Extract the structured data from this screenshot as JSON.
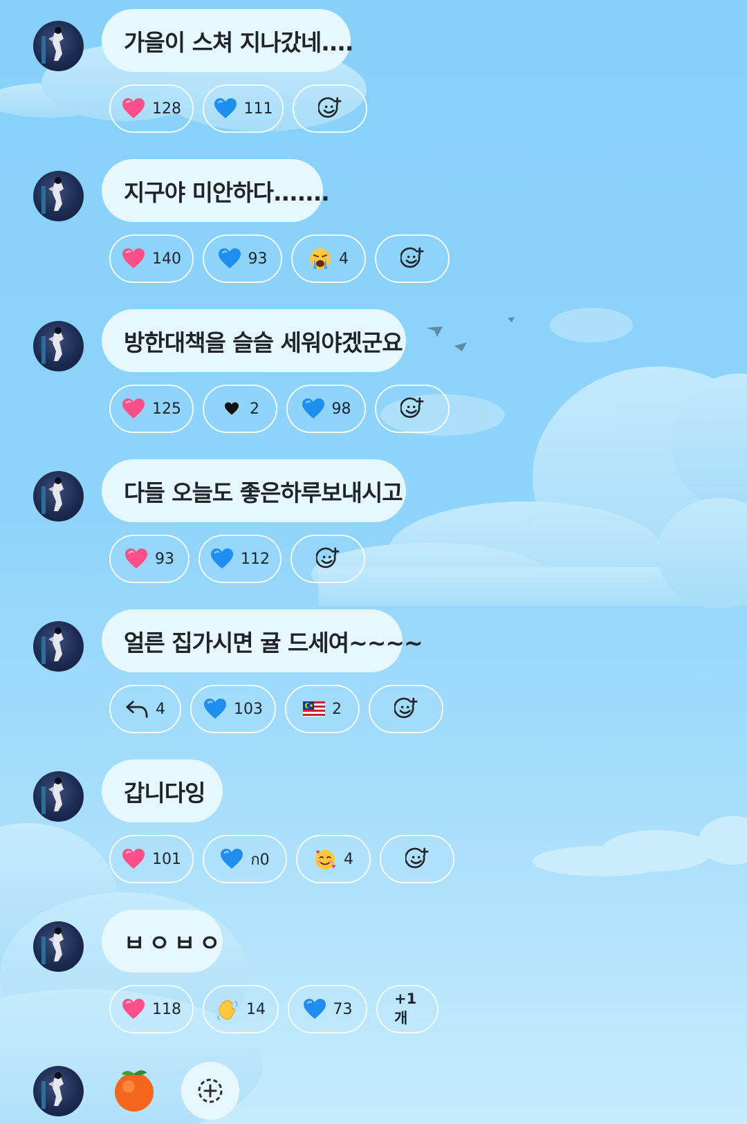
{
  "messages": [
    {
      "text": "가을이 스쳐 지나갔네....",
      "reactions": [
        {
          "icon": "pink-heart",
          "count": "128"
        },
        {
          "icon": "blue-heart",
          "count": "111"
        },
        {
          "icon": "add-reaction",
          "count": ""
        }
      ]
    },
    {
      "text": "지구야 미안하다.......",
      "reactions": [
        {
          "icon": "pink-heart",
          "count": "140"
        },
        {
          "icon": "blue-heart",
          "count": "93"
        },
        {
          "icon": "crying-face",
          "count": "4"
        },
        {
          "icon": "add-reaction",
          "count": ""
        }
      ]
    },
    {
      "text": "방한대책을 슬슬 세워야겠군요",
      "reactions": [
        {
          "icon": "pink-heart",
          "count": "125"
        },
        {
          "icon": "black-heart",
          "count": "2"
        },
        {
          "icon": "blue-heart",
          "count": "98"
        },
        {
          "icon": "add-reaction",
          "count": ""
        }
      ]
    },
    {
      "text": "다들 오늘도 좋은하루보내시고",
      "reactions": [
        {
          "icon": "pink-heart",
          "count": "93"
        },
        {
          "icon": "blue-heart",
          "count": "112"
        },
        {
          "icon": "add-reaction",
          "count": ""
        }
      ]
    },
    {
      "text": "얼른 집가시면 귤 드세여~~~~",
      "reactions": [
        {
          "icon": "reply-arrow",
          "count": "4"
        },
        {
          "icon": "blue-heart",
          "count": "103"
        },
        {
          "icon": "malaysia-flag",
          "count": "2"
        },
        {
          "icon": "add-reaction",
          "count": ""
        }
      ]
    },
    {
      "text": "갑니다잉",
      "reactions": [
        {
          "icon": "pink-heart",
          "count": "101"
        },
        {
          "icon": "blue-heart",
          "count": "ก0"
        },
        {
          "icon": "smiling-face-with-hearts",
          "count": "4"
        },
        {
          "icon": "add-reaction",
          "count": ""
        }
      ]
    },
    {
      "text": "ㅂㅇㅂㅇ",
      "reactions": [
        {
          "icon": "pink-heart",
          "count": "118"
        },
        {
          "icon": "waving-hand",
          "count": "14"
        },
        {
          "icon": "blue-heart",
          "count": "73"
        },
        {
          "icon": "more",
          "count": "+1개"
        }
      ]
    }
  ],
  "last_message": {
    "icon": "tangerine-emoji"
  },
  "colors": {
    "background_top": "#86d0fa",
    "background_bottom": "#c6ecfd",
    "bubble": "#e6f7fe",
    "chip_border": "#f2fbff",
    "pink_heart": "#ff4f8a",
    "blue_heart": "#1e8ff0",
    "text": "#202327"
  }
}
